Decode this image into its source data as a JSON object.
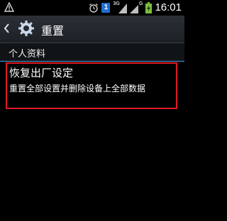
{
  "status_bar": {
    "time": "16:01",
    "sim_slot": "1",
    "network_3g": "3G",
    "network_g": "G",
    "icons": [
      "warning-icon",
      "alarm-clock-icon",
      "sim-1-icon",
      "signal-3g-icon",
      "signal-g-icon",
      "battery-charging-icon"
    ]
  },
  "action_bar": {
    "title": "重置",
    "icons": [
      "back-chevron-icon",
      "settings-gear-icon"
    ]
  },
  "section": {
    "header": "个人资料"
  },
  "reset_item": {
    "title": "恢复出厂设定",
    "summary": "重置全部设置并删除设备上全部数据"
  },
  "colors": {
    "highlight_border": "#e01b24",
    "section_underline": "#4aa3df",
    "sim_badge": "#1e6fd0",
    "battery": "#7bc043"
  }
}
